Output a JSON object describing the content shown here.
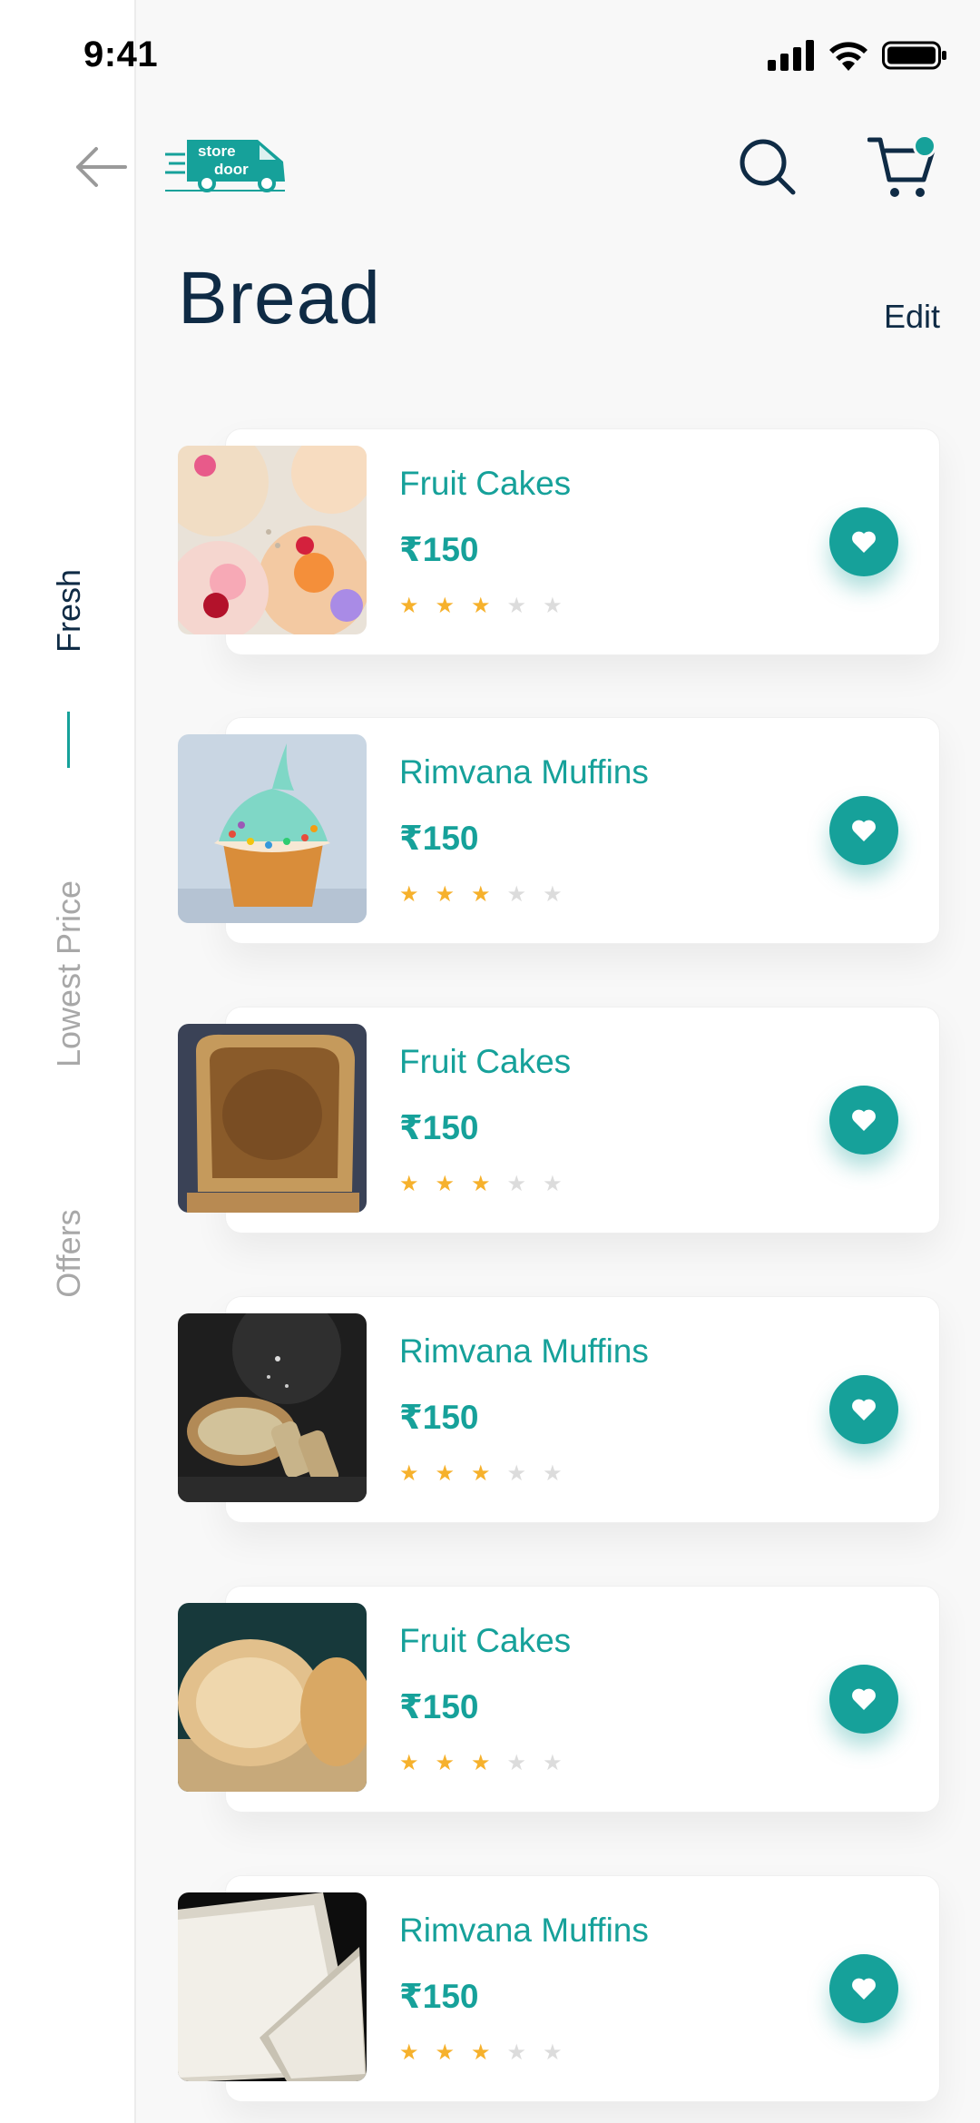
{
  "status_bar": {
    "time": "9:41"
  },
  "header": {
    "logo_line1": "store",
    "logo_line2": "door",
    "title": "Bread",
    "edit_label": "Edit"
  },
  "filters": [
    {
      "label": "Fresh",
      "active": true
    },
    {
      "label": "Lowest Price",
      "active": false
    },
    {
      "label": "Offers",
      "active": false
    }
  ],
  "colors": {
    "accent": "#16a19a",
    "star": "#f6b12c",
    "text_dark": "#0f2b45"
  },
  "products": [
    {
      "name": "Fruit Cakes",
      "price": "₹150",
      "rating": 3,
      "max_rating": 5,
      "image": "fruit-tarts-photo"
    },
    {
      "name": "Rimvana Muffins",
      "price": "₹150",
      "rating": 3,
      "max_rating": 5,
      "image": "cupcake-photo"
    },
    {
      "name": "Fruit Cakes",
      "price": "₹150",
      "rating": 3,
      "max_rating": 5,
      "image": "toast-photo"
    },
    {
      "name": "Rimvana Muffins",
      "price": "₹150",
      "rating": 3,
      "max_rating": 5,
      "image": "sliced-loaf-photo"
    },
    {
      "name": "Fruit Cakes",
      "price": "₹150",
      "rating": 3,
      "max_rating": 5,
      "image": "bread-loaves-photo"
    },
    {
      "name": "Rimvana Muffins",
      "price": "₹150",
      "rating": 3,
      "max_rating": 5,
      "image": "white-bread-photo"
    }
  ]
}
